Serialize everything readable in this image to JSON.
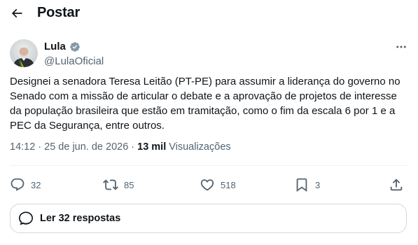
{
  "header": {
    "title": "Postar"
  },
  "author": {
    "name": "Lula",
    "handle": "@LulaOficial"
  },
  "post": {
    "text": "Designei a senadora Teresa Leitão (PT-PE) para assumir a liderança do governo no Senado com a missão de articular o debate e a aprovação de projetos de interesse da população brasileira que estão em tramitação, como o fim da escala 6 por 1 e a PEC da Segurança, entre outros.",
    "time": "14:12",
    "date": "25 de jun. de 2026",
    "views_count": "13 mil",
    "views_label": "Visualizações"
  },
  "actions": {
    "replies": "32",
    "reposts": "85",
    "likes": "518",
    "bookmarks": "3"
  },
  "replies_button": {
    "label": "Ler 32 respostas"
  },
  "colors": {
    "text": "#0f1419",
    "secondary": "#536471",
    "verified": "#829aab",
    "border": "#cfd9de"
  }
}
